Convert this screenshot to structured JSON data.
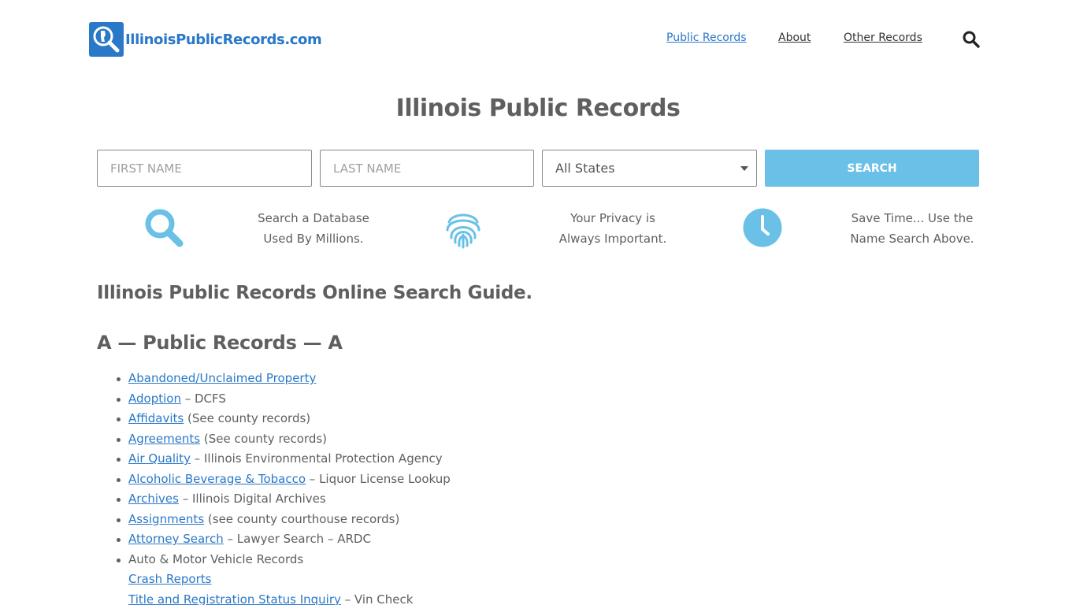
{
  "header": {
    "logo_text": "IllinoisPublicRecords.com",
    "nav": [
      {
        "label": "Public Records"
      },
      {
        "label": "About"
      },
      {
        "label": "Other Records"
      }
    ]
  },
  "page_title": "Illinois Public Records",
  "search_form": {
    "first_name_placeholder": "FIRST NAME",
    "last_name_placeholder": "LAST NAME",
    "state_selected": "All States",
    "search_label": "SEARCH"
  },
  "features": [
    {
      "icon": "magnifier-icon",
      "line1": "Search a Database",
      "line2": "Used By Millions."
    },
    {
      "icon": "fingerprint-icon",
      "line1": "Your Privacy is",
      "line2": "Always Important."
    },
    {
      "icon": "clock-icon",
      "line1": "Save Time... Use the",
      "line2": "Name Search Above."
    }
  ],
  "guide_heading": "Illinois Public Records Online Search Guide.",
  "section_heading": "A — Public Records — A",
  "records": [
    {
      "link": "Abandoned/Unclaimed Property",
      "suffix": ""
    },
    {
      "link": "Adoption",
      "suffix": " – DCFS"
    },
    {
      "link": "Affidavits",
      "suffix": " (See county records)"
    },
    {
      "link": "Agreements",
      "suffix": " (See county records)"
    },
    {
      "link": "Air Quality",
      "suffix": " – Illinois Environmental Protection Agency"
    },
    {
      "link": "Alcoholic Beverage & Tobacco",
      "suffix": " – Liquor License Lookup"
    },
    {
      "link": "Archives",
      "suffix": " – Illinois Digital Archives"
    },
    {
      "link": "Assignments",
      "suffix": " (see county courthouse records)"
    },
    {
      "link": "Attorney Search",
      "suffix": " – Lawyer Search – ARDC"
    },
    {
      "text": "Auto & Motor Vehicle Records"
    },
    {
      "link": "Crash Reports",
      "suffix": ""
    },
    {
      "link": "Title and Registration Status Inquiry",
      "suffix": " – Vin Check"
    }
  ],
  "colors": {
    "brand_blue": "#2a78c8",
    "button_blue": "#6ac0e6",
    "text_gray": "#5f5f5f"
  }
}
